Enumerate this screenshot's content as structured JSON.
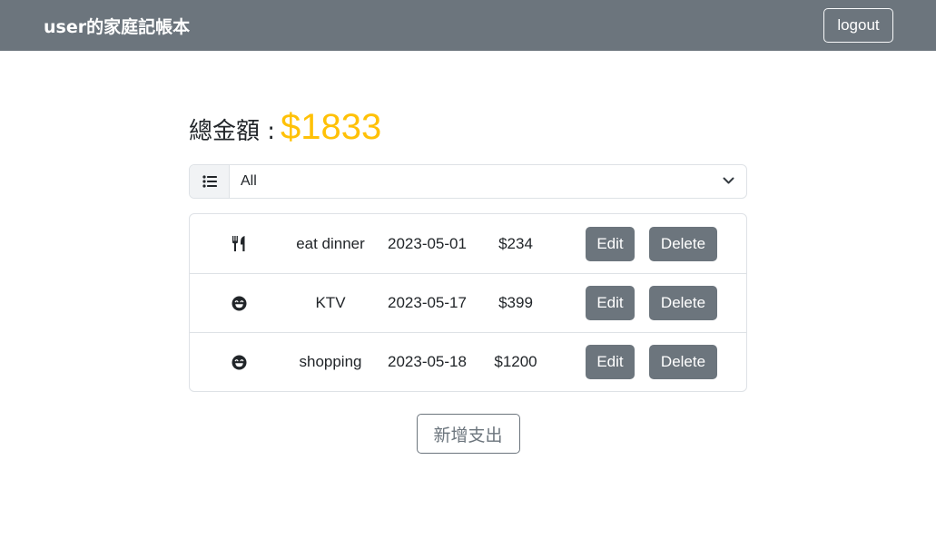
{
  "navbar": {
    "brand": "user的家庭記帳本",
    "logout_label": "logout"
  },
  "summary": {
    "total_label": "總金額 :",
    "total_amount": "$1833",
    "amount_color": "#ffc107"
  },
  "filter": {
    "icon": "list-icon",
    "selected": "All"
  },
  "records": [
    {
      "icon": "utensils-icon",
      "name": "eat dinner",
      "date": "2023-05-01",
      "amount": "$234",
      "edit_label": "Edit",
      "delete_label": "Delete"
    },
    {
      "icon": "smile-icon",
      "name": "KTV",
      "date": "2023-05-17",
      "amount": "$399",
      "edit_label": "Edit",
      "delete_label": "Delete"
    },
    {
      "icon": "smile-icon",
      "name": "shopping",
      "date": "2023-05-18",
      "amount": "$1200",
      "edit_label": "Edit",
      "delete_label": "Delete"
    }
  ],
  "add_button": {
    "label": "新增支出"
  },
  "colors": {
    "navbar": "#6c757d",
    "secondary": "#6c757d",
    "warning": "#ffc107"
  }
}
